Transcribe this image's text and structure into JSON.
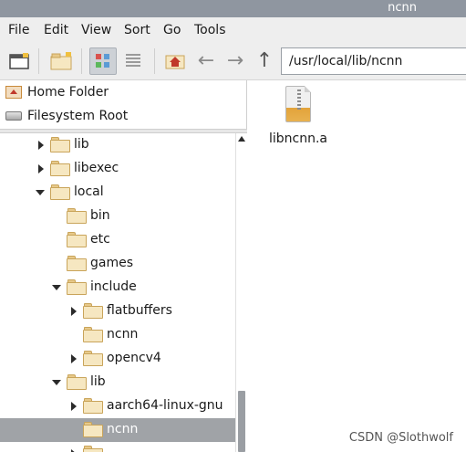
{
  "window": {
    "title": "ncnn"
  },
  "menu": [
    "File",
    "Edit",
    "View",
    "Sort",
    "Go",
    "Tools"
  ],
  "toolbar": {
    "buttons": [
      {
        "icon": "new-window-icon"
      },
      {
        "icon": "new-folder-icon"
      },
      {
        "icon": "icon-view-icon",
        "active": true
      },
      {
        "icon": "list-view-icon"
      },
      {
        "icon": "home-icon"
      },
      {
        "icon": "back-arrow-icon"
      },
      {
        "icon": "forward-arrow-icon"
      },
      {
        "icon": "up-arrow-icon"
      }
    ],
    "path": "/usr/local/lib/ncnn"
  },
  "places": [
    {
      "label": "Home Folder",
      "icon": "home-folder-icon"
    },
    {
      "label": "Filesystem Root",
      "icon": "drive-icon"
    }
  ],
  "tree": [
    {
      "label": "lib",
      "depth": 2,
      "expander": "collapsed"
    },
    {
      "label": "libexec",
      "depth": 2,
      "expander": "collapsed"
    },
    {
      "label": "local",
      "depth": 2,
      "expander": "expanded"
    },
    {
      "label": "bin",
      "depth": 3,
      "expander": "none"
    },
    {
      "label": "etc",
      "depth": 3,
      "expander": "none"
    },
    {
      "label": "games",
      "depth": 3,
      "expander": "none"
    },
    {
      "label": "include",
      "depth": 3,
      "expander": "expanded"
    },
    {
      "label": "flatbuffers",
      "depth": 4,
      "expander": "collapsed"
    },
    {
      "label": "ncnn",
      "depth": 4,
      "expander": "none"
    },
    {
      "label": "opencv4",
      "depth": 4,
      "expander": "collapsed"
    },
    {
      "label": "lib",
      "depth": 3,
      "expander": "expanded"
    },
    {
      "label": "aarch64-linux-gnu",
      "depth": 4,
      "expander": "collapsed"
    },
    {
      "label": "ncnn",
      "depth": 4,
      "expander": "none",
      "selected": true
    },
    {
      "label": "",
      "depth": 4,
      "expander": "collapsed"
    }
  ],
  "files": [
    {
      "name": "libncnn.a",
      "icon": "archive-icon"
    }
  ],
  "watermark": "CSDN @Slothwolf",
  "colors": {
    "titlebar": "#8f96a0",
    "selection": "#a0a3a7",
    "folder": "#f6e7c1"
  }
}
